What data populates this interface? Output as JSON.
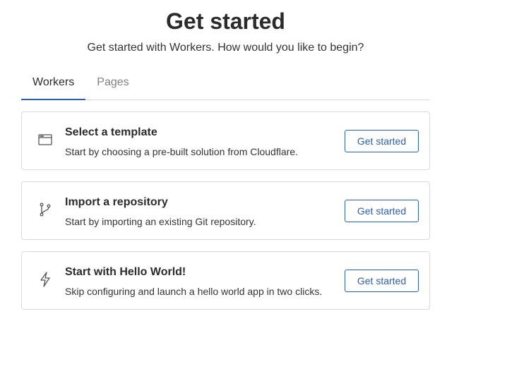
{
  "header": {
    "title": "Get started",
    "subtitle": "Get started with Workers. How would you like to begin?"
  },
  "tabs": [
    {
      "label": "Workers",
      "active": true
    },
    {
      "label": "Pages",
      "active": false
    }
  ],
  "cards": [
    {
      "icon": "browser-window-icon",
      "title": "Select a template",
      "description": "Start by choosing a pre-built solution from Cloudflare.",
      "button": "Get started"
    },
    {
      "icon": "git-branch-icon",
      "title": "Import a repository",
      "description": "Start by importing an existing Git repository.",
      "button": "Get started"
    },
    {
      "icon": "lightning-bolt-icon",
      "title": "Start with Hello World!",
      "description": "Skip configuring and launch a hello world app in two clicks.",
      "button": "Get started"
    }
  ],
  "colors": {
    "accent": "#2c5fb0",
    "border": "#d9d9d9",
    "text": "#2b2b2b",
    "muted": "#808080"
  }
}
